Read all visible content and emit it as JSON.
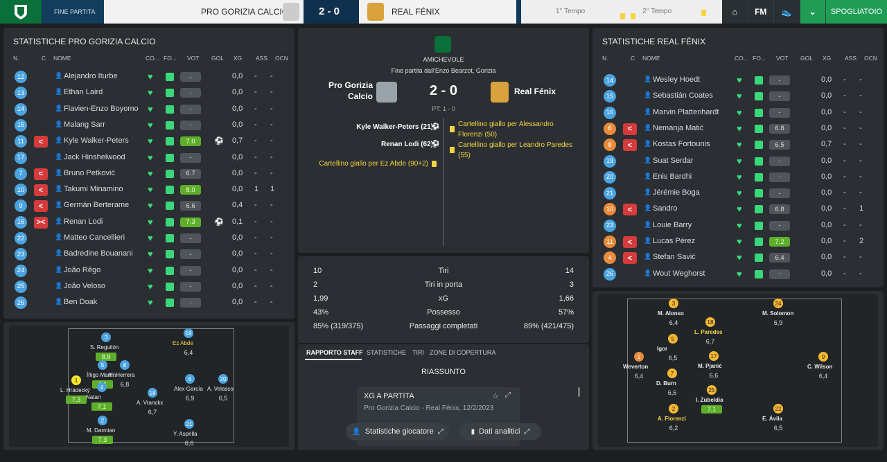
{
  "header": {
    "crumb": "FINE PARTITA",
    "home_team": "PRO GORIZIA CALCIO",
    "score": "2 - 0",
    "away_team": "REAL FÉNIX",
    "first_half": "1° Tempo",
    "second_half": "2° Tempo",
    "nav_fm": "FM",
    "spogliatoio": "SPOGLIATOIO",
    "colors": {
      "brand": "#0b6f3a",
      "accent": "#1f9d55"
    }
  },
  "left_panel": {
    "title": "STATISTICHE PRO GORIZIA CALCIO",
    "headers": [
      "N.",
      "C",
      "NOME",
      "CO...",
      "FO...",
      "VOT",
      "GOL",
      "XG",
      "ASS",
      "OCN"
    ],
    "rows": [
      {
        "num": "12",
        "sub": "",
        "name": "Alejandro Iturbe",
        "rating": "-",
        "good": false,
        "gol": "",
        "xg": "0,0",
        "ass": "-",
        "ocn": "-"
      },
      {
        "num": "13",
        "sub": "",
        "name": "Ethan Laird",
        "rating": "-",
        "good": false,
        "gol": "",
        "xg": "0,0",
        "ass": "-",
        "ocn": "-"
      },
      {
        "num": "14",
        "sub": "",
        "name": "Flavien-Enzo Boyomo",
        "rating": "-",
        "good": false,
        "gol": "",
        "xg": "0,0",
        "ass": "-",
        "ocn": "-"
      },
      {
        "num": "15",
        "sub": "",
        "name": "Malang Sarr",
        "rating": "-",
        "good": false,
        "gol": "",
        "xg": "0,0",
        "ass": "-",
        "ocn": "-"
      },
      {
        "num": "11",
        "sub": "<",
        "name": "Kyle Walker-Peters",
        "rating": "7.0",
        "good": true,
        "gol": "⚽",
        "xg": "0,7",
        "ass": "-",
        "ocn": "-"
      },
      {
        "num": "17",
        "sub": "",
        "name": "Jack Hinshelwood",
        "rating": "-",
        "good": false,
        "gol": "",
        "xg": "0,0",
        "ass": "-",
        "ocn": "-"
      },
      {
        "num": "7",
        "sub": "<",
        "name": "Bruno Petković",
        "rating": "6.7",
        "good": false,
        "gol": "",
        "xg": "0,0",
        "ass": "-",
        "ocn": "-"
      },
      {
        "num": "10",
        "sub": "<",
        "name": "Takumi Minamino",
        "rating": "8.0",
        "good": true,
        "gol": "",
        "xg": "0,0",
        "ass": "1",
        "ocn": "1"
      },
      {
        "num": "9",
        "sub": "<",
        "name": "Germán Berterame",
        "rating": "6.6",
        "good": false,
        "gol": "",
        "xg": "0,4",
        "ass": "-",
        "ocn": "-"
      },
      {
        "num": "16",
        "sub": "><",
        "name": "Renan Lodi",
        "rating": "7.3",
        "good": true,
        "gol": "⚽",
        "xg": "0,1",
        "ass": "-",
        "ocn": "-"
      },
      {
        "num": "22",
        "sub": "",
        "name": "Matteo Cancellieri",
        "rating": "-",
        "good": false,
        "gol": "",
        "xg": "0,0",
        "ass": "-",
        "ocn": "-"
      },
      {
        "num": "23",
        "sub": "",
        "name": "Badredine Bouanani",
        "rating": "-",
        "good": false,
        "gol": "",
        "xg": "0,0",
        "ass": "-",
        "ocn": "-"
      },
      {
        "num": "24",
        "sub": "",
        "name": "João Rêgo",
        "rating": "-",
        "good": false,
        "gol": "",
        "xg": "0,0",
        "ass": "-",
        "ocn": "-"
      },
      {
        "num": "25",
        "sub": "",
        "name": "João Veloso",
        "rating": "-",
        "good": false,
        "gol": "",
        "xg": "0,0",
        "ass": "-",
        "ocn": "-"
      },
      {
        "num": "26",
        "sub": "",
        "name": "Ben Doak",
        "rating": "-",
        "good": false,
        "gol": "",
        "xg": "0,0",
        "ass": "-",
        "ocn": "-"
      }
    ],
    "formation": [
      {
        "num": "3",
        "name": "S. Reguilón",
        "rating": "8,9",
        "good": true,
        "yellow": false
      },
      {
        "num": "19",
        "name": "Ez Abde",
        "rating": "6,4",
        "good": false,
        "yellow": true
      },
      {
        "num": "5",
        "name": "Íñigo Martín.",
        "rating": "7,1",
        "good": true,
        "yellow": false
      },
      {
        "num": "8",
        "name": "H. Herrera",
        "rating": "6,8",
        "good": false,
        "yellow": false
      },
      {
        "num": "1",
        "name": "L. Hrádecký",
        "rating": "7,3",
        "good": true,
        "yellow": false,
        "token": "yellow"
      },
      {
        "num": "4",
        "name": "Natan",
        "rating": "7,1",
        "good": true,
        "yellow": false
      },
      {
        "num": "18",
        "name": "A. Vranckx",
        "rating": "6,7",
        "good": false,
        "yellow": false
      },
      {
        "num": "6",
        "name": "Alex García",
        "rating": "6,9",
        "good": false,
        "yellow": false
      },
      {
        "num": "20",
        "name": "A. Velasco",
        "rating": "6,5",
        "good": false,
        "yellow": false
      },
      {
        "num": "2",
        "name": "M. Darmian",
        "rating": "7,3",
        "good": true,
        "yellow": false
      },
      {
        "num": "21",
        "name": "Y. Asprilla",
        "rating": "6,6",
        "good": false,
        "yellow": false
      }
    ]
  },
  "center": {
    "competition": "AMICHEVOLE",
    "venue": "Fine partita dall'Enzo Bearzot, Gorizia",
    "home": "Pro Gorizia Calcio",
    "score": "2 - 0",
    "away": "Real Fénix",
    "half_time": "PT: 1 - 0",
    "home_events": [
      "Kyle Walker-Peters (21)",
      "Renan Lodi (62)",
      "Cartellino giallo per Ez Abde (90+2)"
    ],
    "away_events": [
      "Cartellino giallo per Alessandro Florenzi (50)",
      "Cartellino giallo per Leandro Paredes (55)"
    ],
    "stats": [
      {
        "home": "10",
        "label": "Tiri",
        "away": "14"
      },
      {
        "home": "2",
        "label": "Tiri in porta",
        "away": "3"
      },
      {
        "home": "1,99",
        "label": "xG",
        "away": "1,66"
      },
      {
        "home": "43%",
        "label": "Possesso",
        "away": "57%"
      },
      {
        "home": "85% (319/375)",
        "label": "Passaggi completati",
        "away": "89% (421/475)"
      }
    ],
    "tabs": [
      "RAPPORTO STAFF",
      "STATISTICHE",
      "TIRI",
      "ZONE DI COPERTURA"
    ],
    "summary_title": "RIASSUNTO",
    "card_title": "XG A PARTITA",
    "card_subtitle": "Pro Gorizia Calcio - Real Fénix, 12/2/2023",
    "btn_players": "Statistiche giocatore",
    "btn_analytics": "Dati analitici"
  },
  "right_panel": {
    "title": "STATISTICHE REAL FÉNIX",
    "headers": [
      "N.",
      "C",
      "NOME",
      "CO...",
      "FO...",
      "VOT",
      "GOL",
      "XG",
      "ASS",
      "OCN"
    ],
    "rows": [
      {
        "num": "14",
        "sub": "",
        "name": "Wesley Hoedt",
        "rating": "-",
        "good": false,
        "xg": "0,0",
        "ass": "-",
        "ocn": "-"
      },
      {
        "num": "15",
        "sub": "",
        "name": "Sebastián Coates",
        "rating": "-",
        "good": false,
        "xg": "0,0",
        "ass": "-",
        "ocn": "-"
      },
      {
        "num": "16",
        "sub": "",
        "name": "Marvin Plattenhardt",
        "rating": "-",
        "good": false,
        "xg": "0,0",
        "ass": "-",
        "ocn": "-"
      },
      {
        "num": "6",
        "sub": "<",
        "name": "Nemanja Matić",
        "rating": "6.8",
        "good": false,
        "xg": "0,0",
        "ass": "-",
        "ocn": "-"
      },
      {
        "num": "8",
        "sub": "<",
        "name": "Kostas Fortounis",
        "rating": "6.5",
        "good": false,
        "xg": "0,7",
        "ass": "-",
        "ocn": "-"
      },
      {
        "num": "19",
        "sub": "",
        "name": "Suat Serdar",
        "rating": "-",
        "good": false,
        "xg": "0,0",
        "ass": "-",
        "ocn": "-"
      },
      {
        "num": "20",
        "sub": "",
        "name": "Enis Bardhi",
        "rating": "-",
        "good": false,
        "xg": "0,0",
        "ass": "-",
        "ocn": "-"
      },
      {
        "num": "21",
        "sub": "",
        "name": "Jérémie Boga",
        "rating": "-",
        "good": false,
        "xg": "0,0",
        "ass": "-",
        "ocn": "-"
      },
      {
        "num": "10",
        "sub": "<",
        "name": "Sandro",
        "rating": "6.8",
        "good": false,
        "xg": "0,0",
        "ass": "-",
        "ocn": "1"
      },
      {
        "num": "23",
        "sub": "",
        "name": "Louie Barry",
        "rating": "-",
        "good": false,
        "xg": "0,0",
        "ass": "-",
        "ocn": "-"
      },
      {
        "num": "11",
        "sub": "<",
        "name": "Lucas Pérez",
        "rating": "7.2",
        "good": true,
        "xg": "0,0",
        "ass": "-",
        "ocn": "2"
      },
      {
        "num": "4",
        "sub": "<",
        "name": "Stefan Savić",
        "rating": "6.4",
        "good": false,
        "xg": "0,0",
        "ass": "-",
        "ocn": "-"
      },
      {
        "num": "26",
        "sub": "",
        "name": "Wout Weghorst",
        "rating": "-",
        "good": false,
        "xg": "0,0",
        "ass": "-",
        "ocn": "-"
      }
    ],
    "formation": [
      {
        "num": "3",
        "name": "M. Alonso",
        "rating": "6,4",
        "yellow": false
      },
      {
        "num": "24",
        "name": "M. Solomon",
        "rating": "6,9",
        "yellow": false
      },
      {
        "num": "18",
        "name": "L. Paredes",
        "rating": "6,7",
        "yellow": true
      },
      {
        "num": "5",
        "name": "Igor",
        "rating": "6,5",
        "yellow": false
      },
      {
        "num": "1",
        "name": "Weverton",
        "rating": "6,4",
        "yellow": false
      },
      {
        "num": "17",
        "name": "M. Pjanić",
        "rating": "6,6",
        "yellow": false
      },
      {
        "num": "9",
        "name": "C. Wilson",
        "rating": "6,4",
        "yellow": false
      },
      {
        "num": "7",
        "name": "D. Burn",
        "rating": "6,6",
        "yellow": false
      },
      {
        "num": "25",
        "name": "I. Zubeldia",
        "rating": "7,1",
        "yellow": false,
        "good": true
      },
      {
        "num": "2",
        "name": "A. Florenzi",
        "rating": "6,2",
        "yellow": true
      },
      {
        "num": "22",
        "name": "E. Ávila",
        "rating": "6,5",
        "yellow": false
      }
    ]
  }
}
